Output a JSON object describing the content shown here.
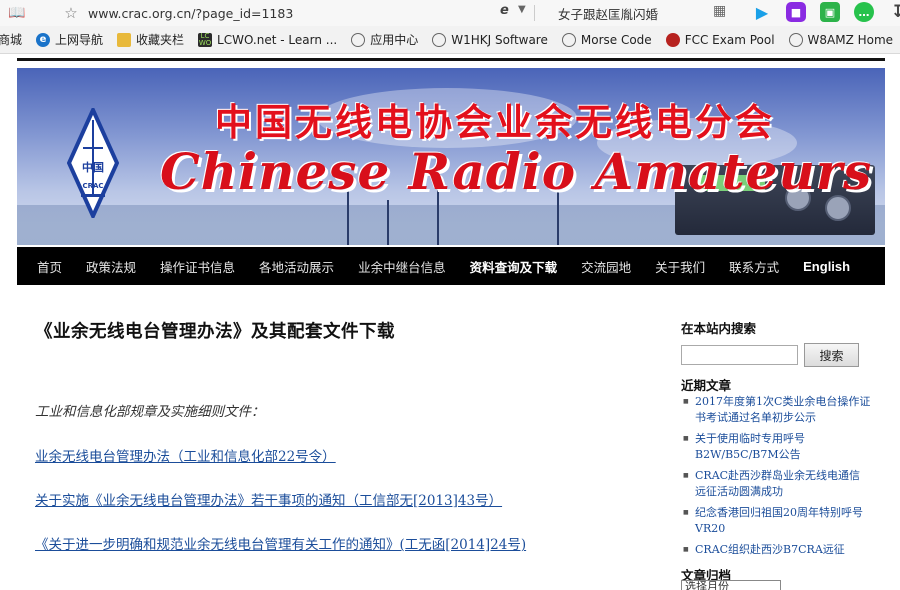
{
  "browser": {
    "url": "www.crac.org.cn/?page_id=1183",
    "search_text": "女子跟赵匡胤闪婚",
    "bookmarks": [
      {
        "label": "商城",
        "icon": "none"
      },
      {
        "label": "上网导航",
        "icon": "ie-icon"
      },
      {
        "label": "收藏夹栏",
        "icon": "folder-icon"
      },
      {
        "label": "LCWO.net - Learn ...",
        "icon": "lcwo-icon"
      },
      {
        "label": "应用中心",
        "icon": "globe-icon"
      },
      {
        "label": "W1HKJ Software",
        "icon": "globe-icon"
      },
      {
        "label": "Morse Code",
        "icon": "globe-icon"
      },
      {
        "label": "FCC Exam Pool",
        "icon": "fcc-icon"
      },
      {
        "label": "W8AMZ Home",
        "icon": "globe-icon"
      }
    ]
  },
  "banner": {
    "title_cn": "中国无线电协会业余无线电分会",
    "title_en": "Chinese Radio Amateurs Club",
    "logo_text": "中国",
    "logo_sub": "CRAC"
  },
  "nav": {
    "items": [
      {
        "label": "首页",
        "active": false
      },
      {
        "label": "政策法规",
        "active": false
      },
      {
        "label": "操作证书信息",
        "active": false
      },
      {
        "label": "各地活动展示",
        "active": false
      },
      {
        "label": "业余中继台信息",
        "active": false
      },
      {
        "label": "资料查询及下载",
        "active": true
      },
      {
        "label": "交流园地",
        "active": false
      },
      {
        "label": "关于我们",
        "active": false
      },
      {
        "label": "联系方式",
        "active": false
      },
      {
        "label": "English",
        "active": false
      }
    ]
  },
  "post": {
    "title": "《业余无线电台管理办法》及其配套文件下载",
    "intro": "工业和信息化部规章及实施细则文件：",
    "links": [
      "业余无线电台管理办法（工业和信息化部22号令）",
      "关于实施《业余无线电台管理办法》若干事项的通知（工信部无[2013]43号）",
      "《关于进一步明确和规范业余无线电台管理有关工作的通知》(工无函[2014]24号)"
    ]
  },
  "sidebar": {
    "search_title": "在本站内搜索",
    "search_button": "搜索",
    "search_value": "",
    "recent_title": "近期文章",
    "recent_posts": [
      "2017年度第1次C类业余电台操作证书考试通过名单初步公示",
      "关于使用临时专用呼号B2W/B5C/B7M公告",
      "CRAC赴西沙群岛业余无线电通信远征活动圆满成功",
      "纪念香港回归祖国20周年特别呼号VR20",
      "CRAC组织赴西沙B7CRA远征"
    ],
    "archive_title": "文章归档",
    "archive_select": "选择月份"
  }
}
